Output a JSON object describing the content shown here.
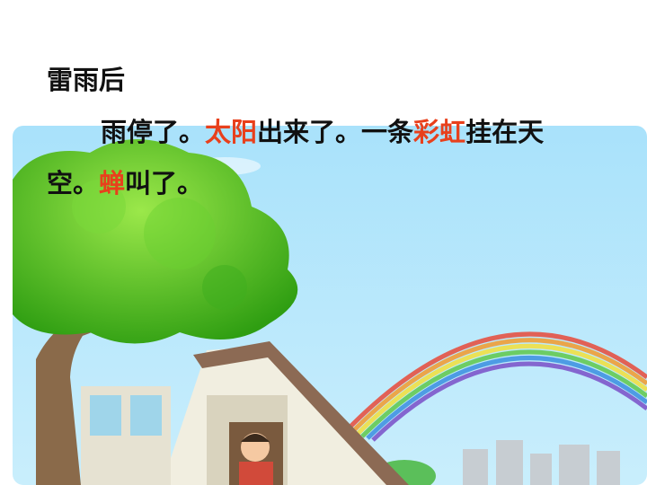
{
  "title": "雷雨后",
  "paragraph": {
    "line1": {
      "s1": "雨停了。",
      "h1": "太阳",
      "s2": "出来了。一条",
      "h2": "彩虹",
      "s3": "挂在天"
    },
    "line2": {
      "s1": "空。",
      "h1": "蝉",
      "s2": "叫了。"
    }
  },
  "colors": {
    "highlight": "#e8401c",
    "text": "#111111",
    "sky": "#8ad3f5",
    "tree": "#4cc41c"
  },
  "illustration": {
    "subjects": [
      "sky-icon",
      "tree-icon",
      "house-icon",
      "rainbow-icon",
      "child-icon",
      "city-icon"
    ]
  }
}
